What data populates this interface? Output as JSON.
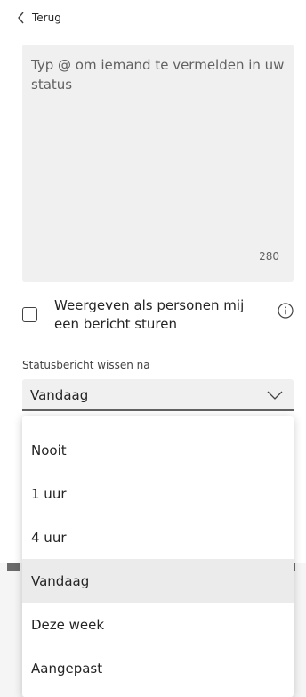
{
  "header": {
    "back_label": "Terug"
  },
  "status_input": {
    "placeholder": "Typ @ om iemand te vermelden in uw status",
    "char_count": "280"
  },
  "show_when_messaged": {
    "label": "Weergeven als personen mij een bericht sturen",
    "checked": false
  },
  "clear_after": {
    "label": "Statusbericht wissen na",
    "selected": "Vandaag",
    "options": [
      "Nooit",
      "1 uur",
      "4 uur",
      "Vandaag",
      "Deze week",
      "Aangepast"
    ]
  }
}
